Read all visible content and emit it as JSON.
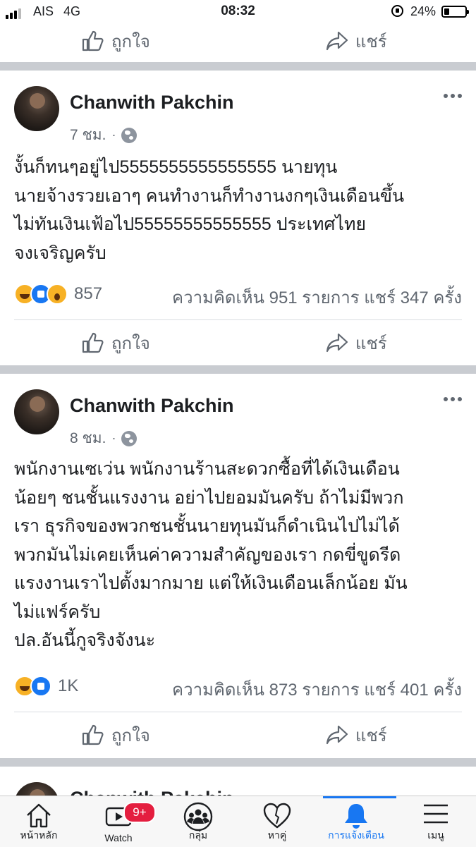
{
  "status_bar": {
    "carrier": "AIS",
    "network": "4G",
    "time": "08:32",
    "battery": "24%",
    "battery_level": 0.24
  },
  "actions": {
    "like": "ถูกใจ",
    "share": "แชร์"
  },
  "posts": [
    {
      "author": "Chanwith Pakchin",
      "time": "7 ชม.",
      "dot": "·",
      "privacy_icon": "globe-icon",
      "text": "งั้นก็ทนๆอยู่ไป5555555555555555 นายทุน\nนายจ้างรวยเอาๆ คนทำงานก็ทำงานงกๆเงินเดือนขึ้น\nไม่ทันเงินเฟ้อไป55555555555555 ประเทศไทย\nจงเจริญครับ",
      "reactions": [
        "haha",
        "like",
        "wow"
      ],
      "reaction_count": "857",
      "counts": "ความคิดเห็น 951 รายการ  แชร์ 347 ครั้ง"
    },
    {
      "author": "Chanwith Pakchin",
      "time": "8 ชม.",
      "dot": "·",
      "privacy_icon": "globe-icon",
      "text": "พนักงานเซเว่น พนักงานร้านสะดวกซื้อที่ได้เงินเดือน\nน้อยๆ ชนชั้นแรงงาน อย่าไปยอมมันครับ ถ้าไม่มีพวก\nเรา ธุรกิจของพวกชนชั้นนายทุนมันก็ดำเนินไปไม่ได้\nพวกมันไม่เคยเห็นค่าความสำคัญของเรา กดขี่ขูดรีด\nแรงงานเราไปตั้งมากมาย แต่ให้เงินเดือนเล็กน้อย มัน\nไม่แฟร์ครับ\nปล.อันนี้กูจริงจังนะ",
      "reactions": [
        "haha",
        "like"
      ],
      "reaction_count": "1K",
      "counts": "ความคิดเห็น 873 รายการ  แชร์ 401 ครั้ง"
    },
    {
      "author": "Chanwith Pakchin"
    }
  ],
  "tab_bar": [
    {
      "label": "หน้าหลัก",
      "icon": "home-icon"
    },
    {
      "label": "Watch",
      "icon": "watch-icon",
      "badge": "9+"
    },
    {
      "label": "กลุ่ม",
      "icon": "groups-icon"
    },
    {
      "label": "หาคู่",
      "icon": "dating-heart-icon"
    },
    {
      "label": "การแจ้งเตือน",
      "icon": "bell-icon",
      "active": true
    },
    {
      "label": "เมนู",
      "icon": "menu-icon"
    }
  ],
  "colors": {
    "accent": "#1877f2",
    "separator": "#c9ccd1",
    "secondary_text": "#606770",
    "badge": "#e41e3f"
  }
}
